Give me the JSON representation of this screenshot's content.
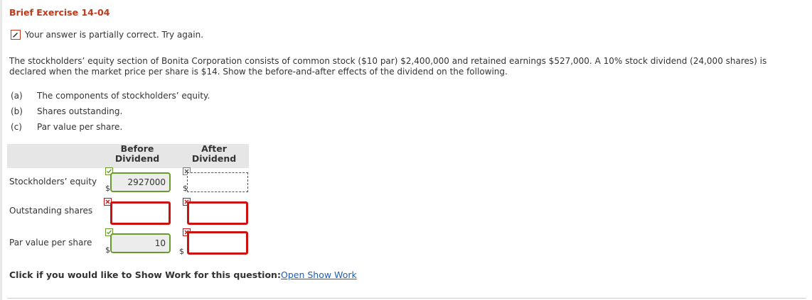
{
  "title": "Brief Exercise 14-04",
  "status": {
    "text": "Your answer is partially correct.  Try again.",
    "icon": "pencil-edit-icon"
  },
  "question": "The stockholders’ equity section of Bonita Corporation consists of common stock ($10 par) $2,400,000 and retained earnings $527,000. A 10% stock dividend (24,000 shares) is declared when the market price per share is $14. Show the before-and-after effects of the dividend on the following.",
  "parts": [
    {
      "letter": "(a)",
      "text": "The components of stockholders’ equity."
    },
    {
      "letter": "(b)",
      "text": "Shares outstanding."
    },
    {
      "letter": "(c)",
      "text": "Par value per share."
    }
  ],
  "table": {
    "before_header": "Before\nDividend",
    "after_header": "After\nDividend",
    "rows": [
      {
        "label": "Stockholders’ equity",
        "before_prefix": "$",
        "before_value": "2927000",
        "after_prefix": "$",
        "after_value": ""
      },
      {
        "label": "Outstanding shares",
        "before_prefix": "",
        "before_value": "",
        "after_prefix": "",
        "after_value": ""
      },
      {
        "label": "Par value per share",
        "before_prefix": "$",
        "before_value": "10",
        "after_prefix": "$",
        "after_value": ""
      }
    ]
  },
  "show_work": {
    "prompt": "Click if you would like to Show Work for this question:",
    "link": "Open Show Work"
  },
  "colors": {
    "title": "#c0391b",
    "correct": "#6a9a2c",
    "incorrect": "#cc1111",
    "link": "#1a5fb4"
  }
}
